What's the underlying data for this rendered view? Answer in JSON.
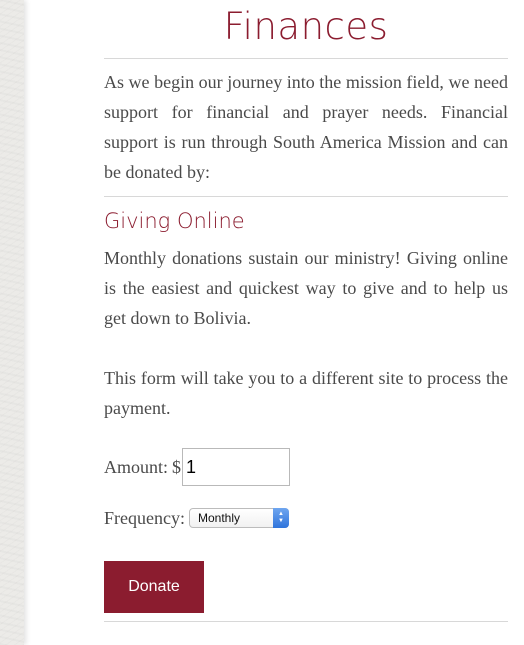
{
  "page": {
    "title": "Finances",
    "intro": "As we begin our journey into the mission field, we need support for financial and prayer needs. Financial support is run through South America Mission and can be donated by:"
  },
  "giving": {
    "heading": "Giving Online",
    "monthly_text": "Monthly donations sustain our ministry! Giving online is the easiest and quickest way to give and to help us get down to Bolivia.",
    "form_note": "This form will take you to a different site to process the payment."
  },
  "form": {
    "amount_label": "Amount:",
    "currency_symbol": "$",
    "amount_value": "1",
    "frequency_label": "Frequency:",
    "frequency_selected": "Monthly",
    "donate_label": "Donate"
  },
  "colors": {
    "accent": "#8b1c2f",
    "body_text": "#4a4a4a"
  },
  "icons": {
    "select_arrows": "chevron-up-down-icon"
  }
}
